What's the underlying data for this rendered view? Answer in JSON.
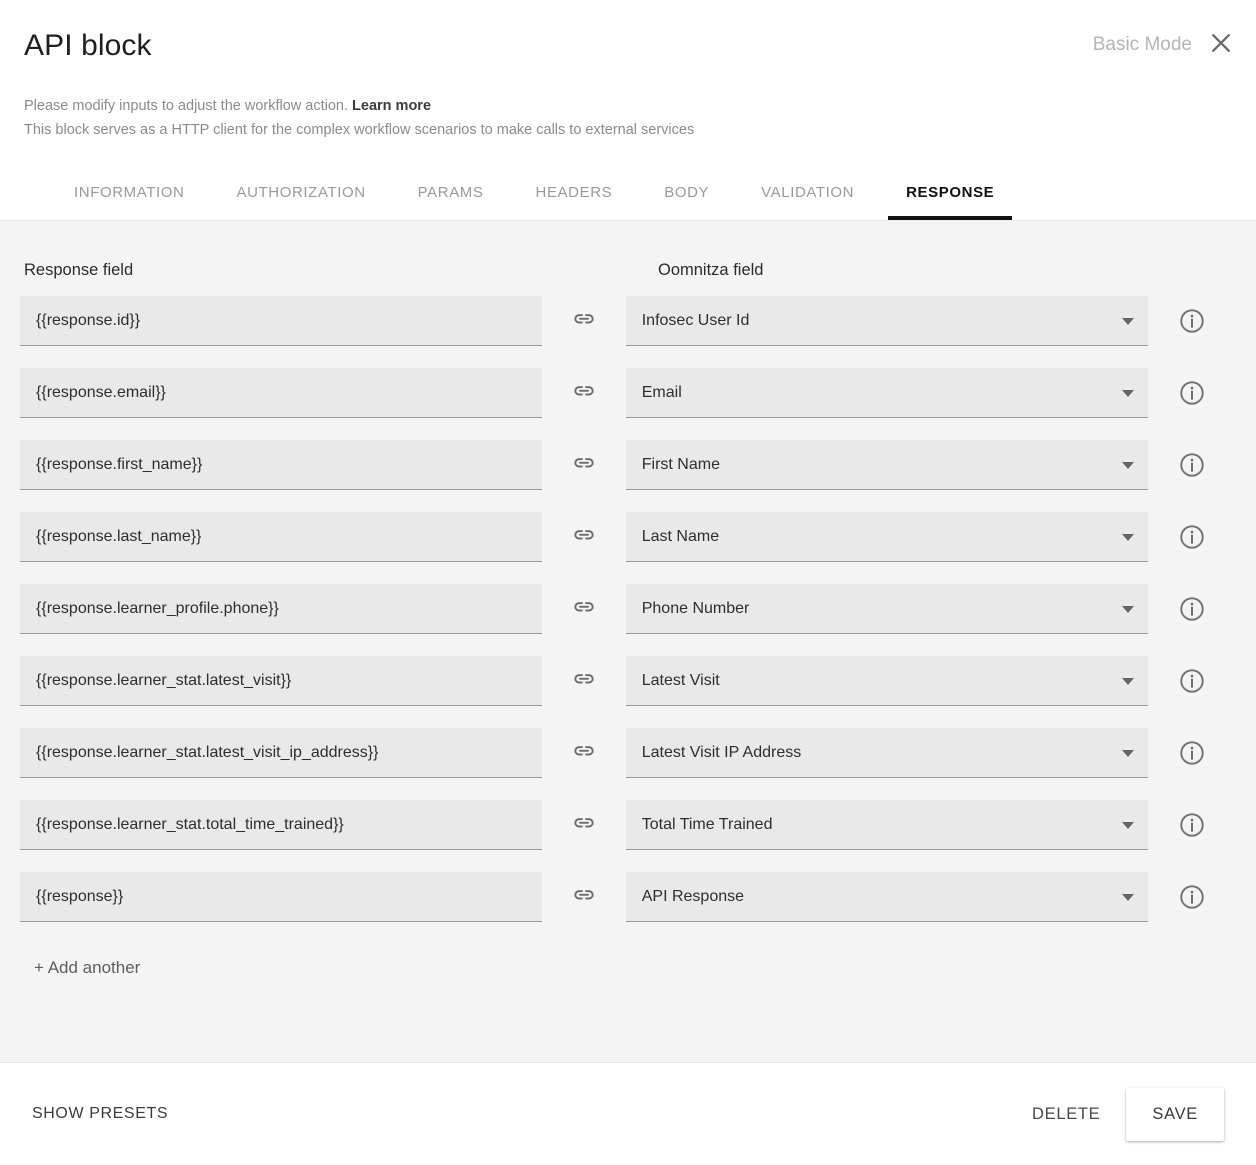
{
  "header": {
    "title": "API block",
    "mode_label": "Basic Mode",
    "close_icon": "close-icon",
    "subtitle_line1_text": "Please modify inputs to adjust the workflow action.",
    "subtitle_learn_more": "Learn more",
    "subtitle_line2": "This block serves as a HTTP client for the complex workflow scenarios to make calls to external services"
  },
  "tabs": [
    {
      "label": "INFORMATION",
      "active": false
    },
    {
      "label": "AUTHORIZATION",
      "active": false
    },
    {
      "label": "PARAMS",
      "active": false
    },
    {
      "label": "HEADERS",
      "active": false
    },
    {
      "label": "BODY",
      "active": false
    },
    {
      "label": "VALIDATION",
      "active": false
    },
    {
      "label": "RESPONSE",
      "active": true
    }
  ],
  "main": {
    "columns": {
      "response_field": "Response field",
      "oomnitza_field": "Oomnitza field"
    },
    "link_icon": "link-icon",
    "info_icon": "info-icon",
    "dropdown_icon": "chevron-down-icon",
    "rows": [
      {
        "response": "{{response.id}}",
        "oomnitza": "Infosec User Id"
      },
      {
        "response": "{{response.email}}",
        "oomnitza": "Email"
      },
      {
        "response": "{{response.first_name}}",
        "oomnitza": "First Name"
      },
      {
        "response": "{{response.last_name}}",
        "oomnitza": "Last Name"
      },
      {
        "response": "{{response.learner_profile.phone}}",
        "oomnitza": "Phone Number"
      },
      {
        "response": "{{response.learner_stat.latest_visit}}",
        "oomnitza": "Latest Visit"
      },
      {
        "response": "{{response.learner_stat.latest_visit_ip_address}}",
        "oomnitza": "Latest Visit IP Address"
      },
      {
        "response": "{{response.learner_stat.total_time_trained}}",
        "oomnitza": "Total Time Trained"
      },
      {
        "response": "{{response}}",
        "oomnitza": "API Response"
      }
    ],
    "add_another_label": "+ Add another"
  },
  "footer": {
    "show_presets_label": "SHOW PRESETS",
    "delete_label": "DELETE",
    "save_label": "SAVE"
  },
  "colors": {
    "panel_background": "#f4f4f4",
    "field_background": "#e9e9e9",
    "active_tab": "#111111",
    "muted_text": "#9b9b9b"
  }
}
